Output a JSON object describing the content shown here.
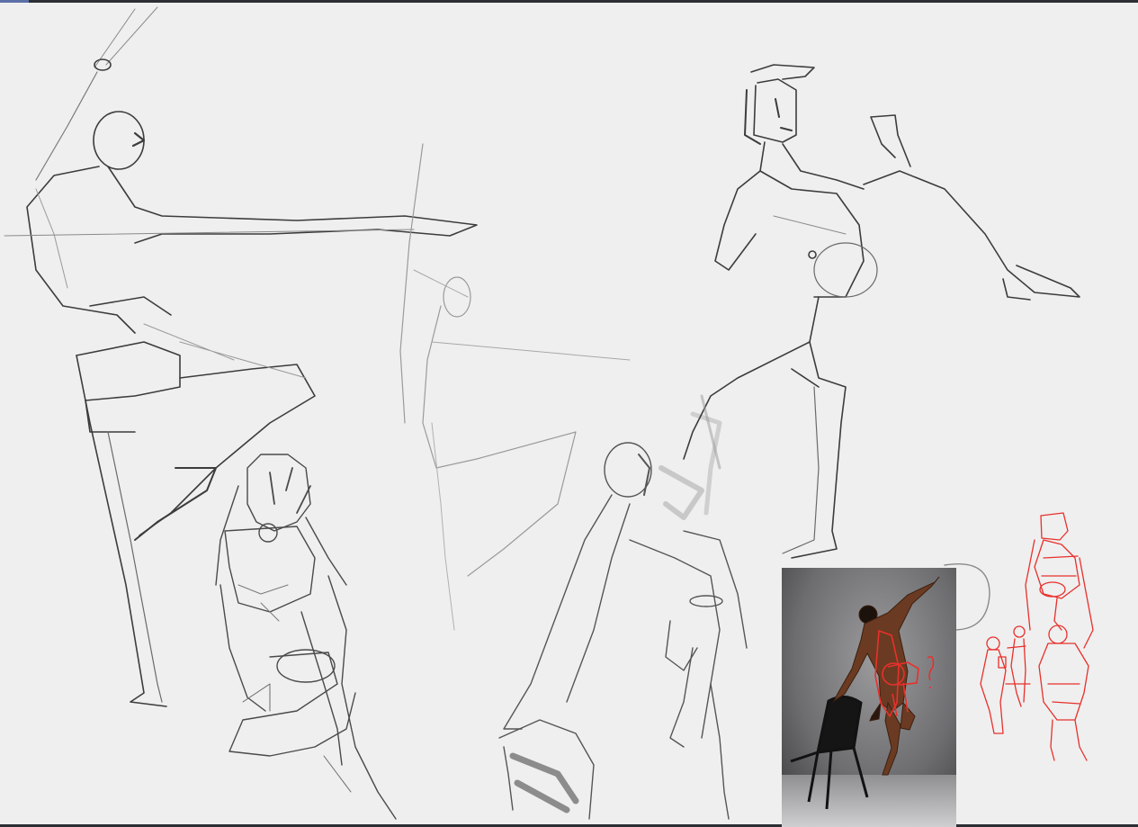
{
  "app": {
    "window_title": "",
    "toolbar_accent": "#5b6fa8"
  },
  "canvas": {
    "background": "#efefef",
    "stroke_colors": {
      "pencil": "#3c3c3c",
      "light_pencil": "#9a9a9a",
      "red": "#e8302c"
    }
  },
  "layers": [
    {
      "name": "gesture-sketches",
      "color": "#3c3c3c"
    },
    {
      "name": "red-mannequins",
      "color": "#e8302c"
    },
    {
      "name": "reference-photo",
      "kind": "image"
    }
  ],
  "reference": {
    "annotation_marks": "?"
  }
}
